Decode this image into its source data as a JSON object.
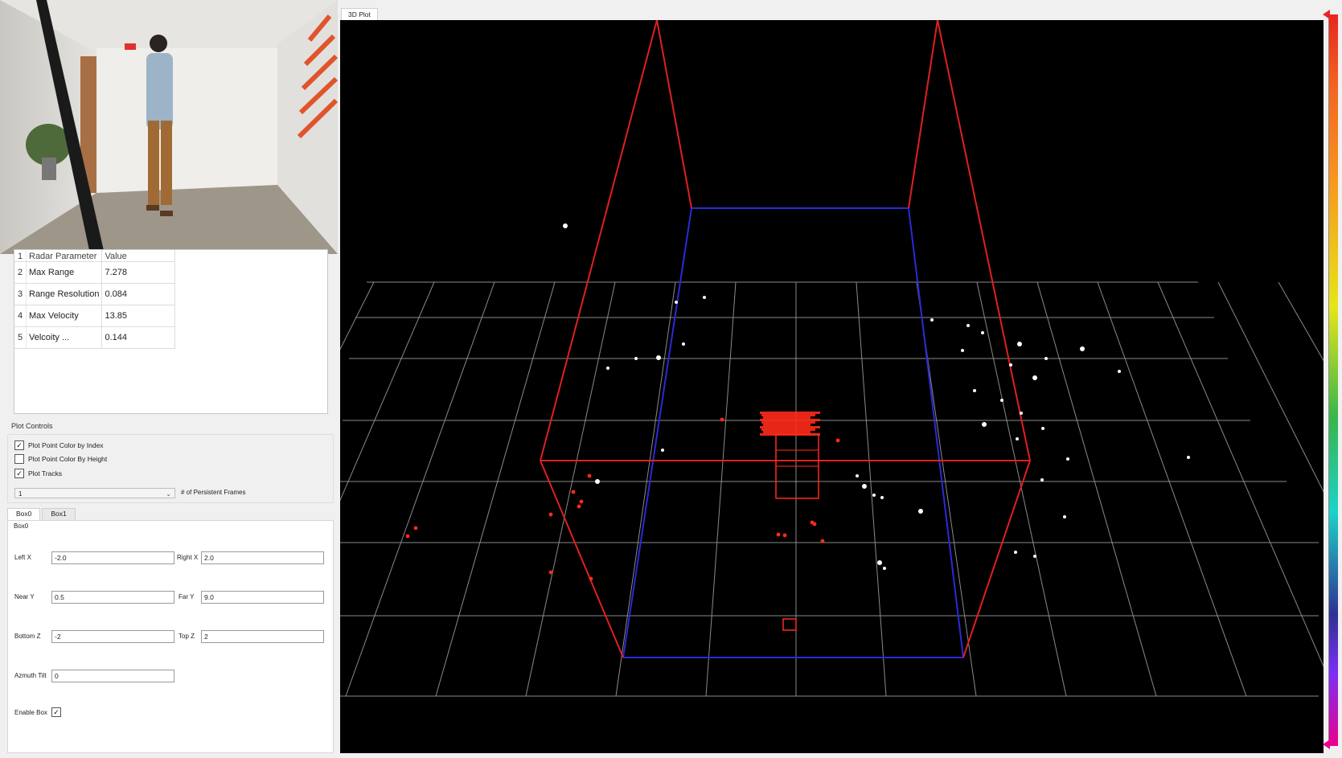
{
  "camera": {
    "description_hidden": true
  },
  "radar_table": {
    "columns": [
      "Radar Parameter",
      "Value"
    ],
    "rows": [
      {
        "index": "1",
        "param": "Radar Parameter",
        "value": "Value"
      },
      {
        "index": "2",
        "param": "Max Range",
        "value": "7.278"
      },
      {
        "index": "3",
        "param": "Range Resolution",
        "value": "0.084"
      },
      {
        "index": "4",
        "param": "Max Velocity",
        "value": "13.85"
      },
      {
        "index": "5",
        "param": "Velcoity ...",
        "value": "0.144"
      }
    ]
  },
  "plot_controls": {
    "title": "Plot Controls",
    "color_by_index": {
      "label": "Plot Point Color by Index",
      "checked": true
    },
    "color_by_height": {
      "label": "Plot Point Color By Height",
      "checked": false
    },
    "plot_tracks": {
      "label": "Plot Tracks",
      "checked": true
    },
    "persistent_frames": {
      "value": "1",
      "label": "# of Persistent Frames"
    }
  },
  "box_tabs": {
    "tabs": [
      "Box0",
      "Box1"
    ],
    "active": "Box0",
    "panel_title": "Box0",
    "fields": {
      "left_x": {
        "label": "Left X",
        "value": "-2.0"
      },
      "right_x": {
        "label": "Right X",
        "value": "2.0"
      },
      "near_y": {
        "label": "Near Y",
        "value": "0.5"
      },
      "far_y": {
        "label": "Far Y",
        "value": "9.0"
      },
      "bottom_z": {
        "label": "Bottom Z",
        "value": "-2"
      },
      "top_z": {
        "label": "Top Z",
        "value": "2"
      },
      "azimuth_tilt": {
        "label": "Azmuth Tilt",
        "value": "0"
      }
    },
    "enable_box": {
      "label": "Enable Box",
      "checked": true
    }
  },
  "plot": {
    "tab_label": "3D Plot",
    "background": "#000000",
    "grid_color": "#8a8a8a",
    "box_near_color": "#e02020",
    "box_far_color": "#2a2ad8",
    "track_color": "#ff2a1a",
    "point_color": "#ffffff"
  },
  "colorbar": {
    "top_color": "#e8251f",
    "bottom_color": "#ec008c"
  }
}
